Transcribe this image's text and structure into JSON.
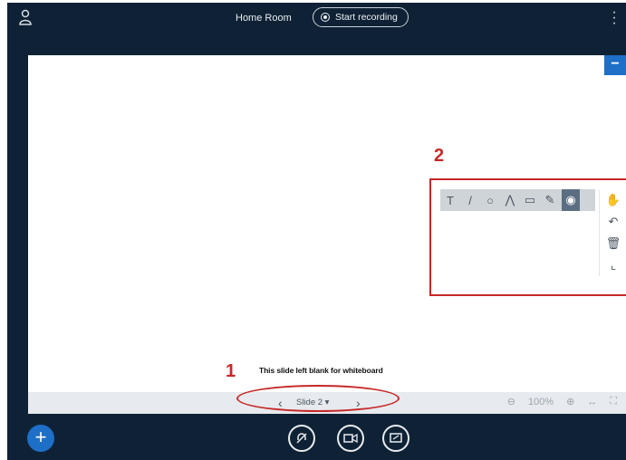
{
  "topbar": {
    "room_title": "Home Room",
    "recording_label": "Start recording",
    "icons": {
      "user": "user-icon",
      "menu": "more-vertical-icon"
    }
  },
  "stage": {
    "minimize_label": "−",
    "slide_caption": "This slide left blank for whiteboard",
    "whiteboard_tools": [
      "T",
      "/",
      "○",
      "⋀",
      "▭",
      "✎",
      "◉",
      "✋"
    ],
    "side_tools": [
      "undo-icon",
      "clear-icon",
      "multi-user-icon"
    ],
    "slide_select": "Slide 2 ▾",
    "zoom_value": "100%"
  },
  "annotations": {
    "label_1": "1",
    "label_2": "2",
    "color": "#c62828"
  },
  "colors": {
    "background": "#0f2235",
    "accent": "#1d6fc7",
    "toolbar": "#cfd4d9"
  }
}
